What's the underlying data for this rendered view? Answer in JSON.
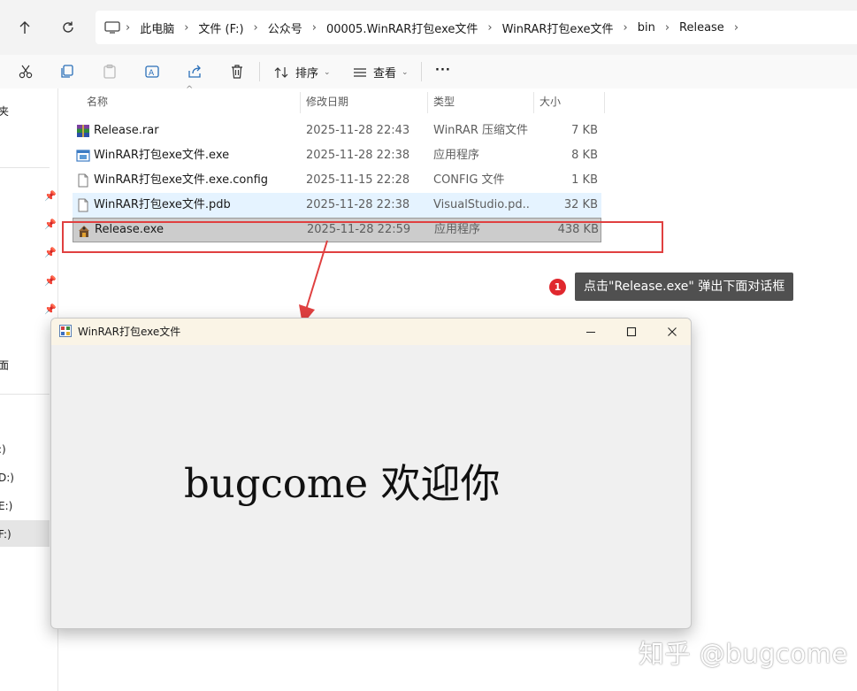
{
  "address_bar": {
    "breadcrumbs": [
      "此电脑",
      "文件 (F:)",
      "公众号",
      "00005.WinRAR打包exe文件",
      "WinRAR打包exe文件",
      "bin",
      "Release"
    ]
  },
  "toolbar": {
    "sort_label": "排序",
    "view_label": "查看",
    "more_label": "···"
  },
  "left_pane": {
    "items": [
      "夹",
      "面",
      ":)",
      "D:)",
      "E:)",
      "F:)"
    ]
  },
  "file_list": {
    "columns": [
      "名称",
      "修改日期",
      "类型",
      "大小"
    ],
    "rows": [
      {
        "name": "Release.rar",
        "date": "2025-11-28 22:43",
        "type": "WinRAR 压缩文件",
        "size": "7 KB",
        "icon": "rar-archive-icon"
      },
      {
        "name": "WinRAR打包exe文件.exe",
        "date": "2025-11-28 22:38",
        "type": "应用程序",
        "size": "8 KB",
        "icon": "application-icon"
      },
      {
        "name": "WinRAR打包exe文件.exe.config",
        "date": "2025-11-15 22:28",
        "type": "CONFIG 文件",
        "size": "1 KB",
        "icon": "file-icon"
      },
      {
        "name": "WinRAR打包exe文件.pdb",
        "date": "2025-11-28 22:38",
        "type": "VisualStudio.pd...",
        "size": "32 KB",
        "icon": "file-icon"
      },
      {
        "name": "Release.exe",
        "date": "2025-11-28 22:59",
        "type": "应用程序",
        "size": "438 KB",
        "icon": "sfx-archive-icon"
      }
    ]
  },
  "annotation": {
    "number": "1",
    "text": "点击\"Release.exe\" 弹出下面对话框",
    "color": "#e0282e"
  },
  "dialog": {
    "title": "WinRAR打包exe文件",
    "body_text": "bugcome 欢迎你"
  },
  "watermark": {
    "text": "知乎 @bugcome"
  }
}
